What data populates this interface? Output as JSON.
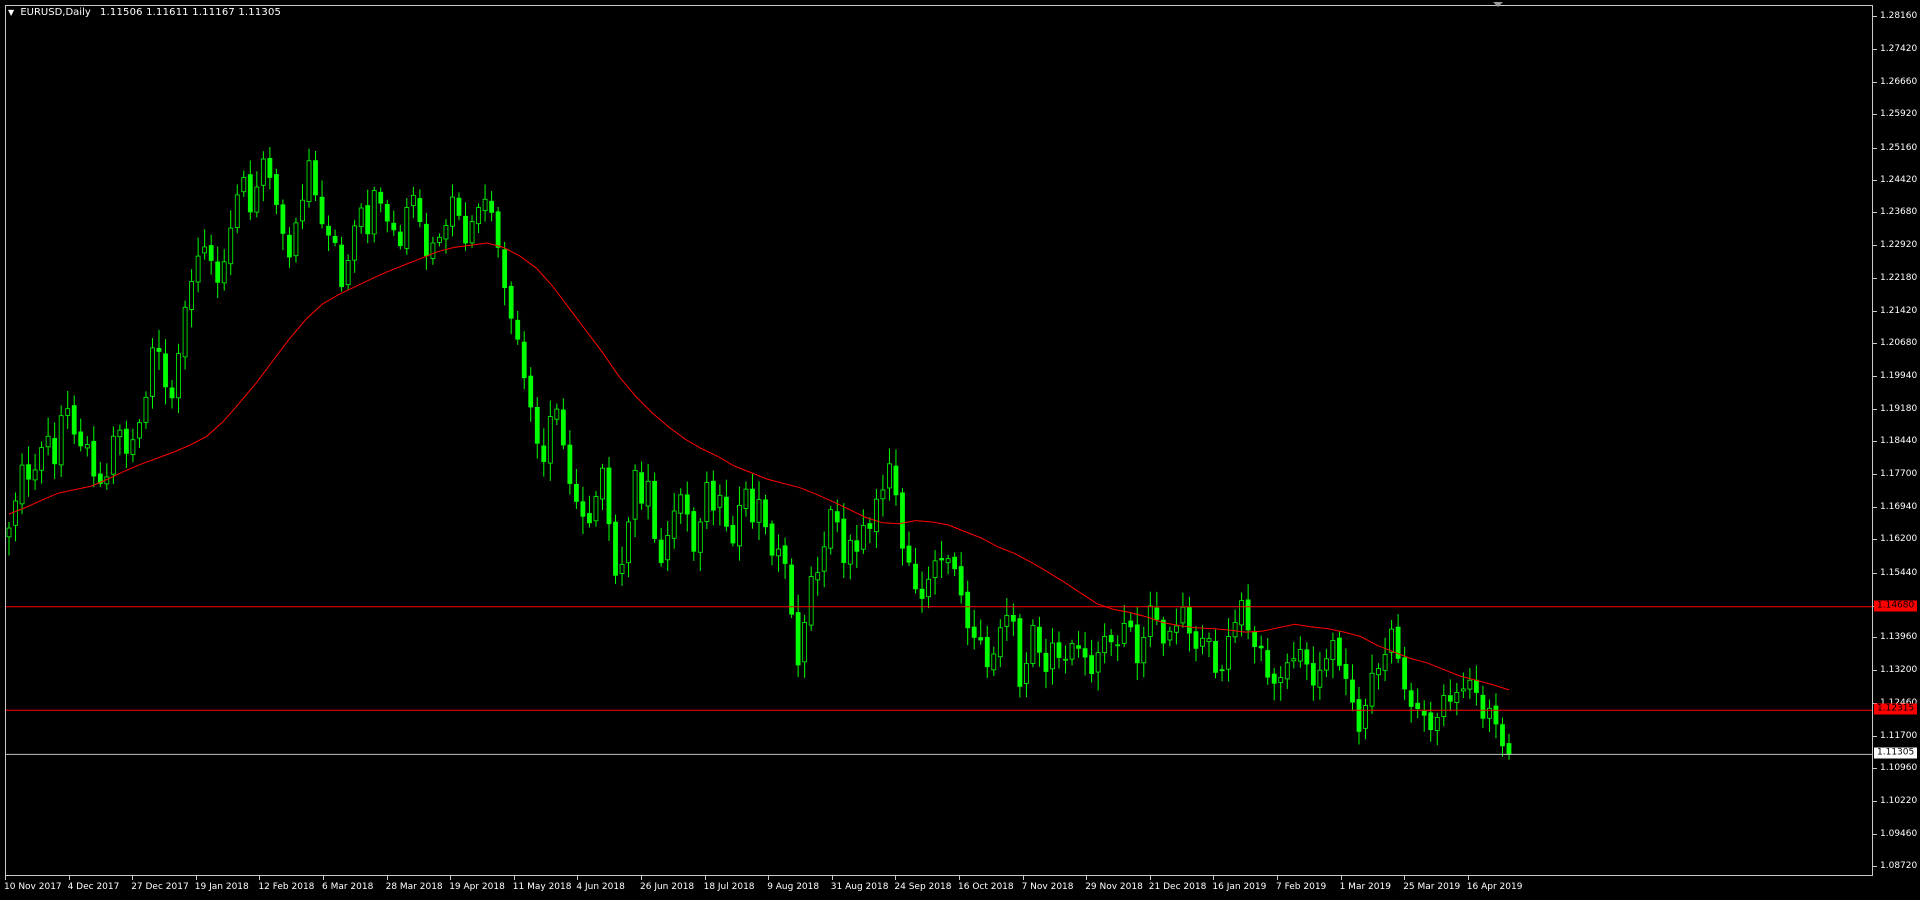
{
  "header": {
    "symbol": "EURUSD,Daily",
    "ohlc": "1.11506 1.11611 1.11167 1.11305"
  },
  "icons": {
    "menu": "triangle-down-icon",
    "scroll": "scroll-marker-icon"
  },
  "colors": {
    "background": "#000000",
    "bull": "#00ff00",
    "bear": "#00ff00",
    "moving_average": "#ff0000",
    "horizontal_level": "#ff0000",
    "bid_line": "#c0c0c0",
    "axis": "#c8c8c8"
  },
  "chart_data": {
    "type": "candlestick",
    "symbol": "EURUSD",
    "timeframe": "Daily",
    "ylim": [
      1.085,
      1.2842
    ],
    "x_tick_labels": [
      "10 Nov 2017",
      "4 Dec 2017",
      "27 Dec 2017",
      "19 Jan 2018",
      "12 Feb 2018",
      "6 Mar 2018",
      "28 Mar 2018",
      "19 Apr 2018",
      "11 May 2018",
      "4 Jun 2018",
      "26 Jun 2018",
      "18 Jul 2018",
      "9 Aug 2018",
      "31 Aug 2018",
      "24 Sep 2018",
      "16 Oct 2018",
      "7 Nov 2018",
      "29 Nov 2018",
      "21 Dec 2018",
      "16 Jan 2019",
      "7 Feb 2019",
      "1 Mar 2019",
      "25 Mar 2019",
      "16 Apr 2019"
    ],
    "y_tick_labels": [
      "1.28160",
      "1.27420",
      "1.26660",
      "1.25920",
      "1.25160",
      "1.24420",
      "1.23680",
      "1.22920",
      "1.22180",
      "1.21420",
      "1.20680",
      "1.19940",
      "1.19180",
      "1.18440",
      "1.17700",
      "1.16940",
      "1.16200",
      "1.15440",
      "1.14680",
      "1.13960",
      "1.13200",
      "1.12460",
      "1.11700",
      "1.10960",
      "1.10220",
      "1.09460",
      "1.08720"
    ],
    "grid": false,
    "close_series": [
      1.1648,
      1.171,
      1.1792,
      1.176,
      1.1781,
      1.1832,
      1.1858,
      1.1795,
      1.1905,
      1.1921,
      1.1863,
      1.1836,
      1.1839,
      1.1767,
      1.175,
      1.1765,
      1.1858,
      1.1872,
      1.1819,
      1.185,
      1.1889,
      1.1947,
      1.206,
      1.2052,
      1.1971,
      1.1946,
      1.2047,
      1.2153,
      1.2212,
      1.227,
      1.2291,
      1.226,
      1.221,
      1.2257,
      1.2334,
      1.241,
      1.245,
      1.2371,
      1.2428,
      1.2492,
      1.245,
      1.2388,
      1.2322,
      1.2268,
      1.2346,
      1.2398,
      1.2488,
      1.241,
      1.2344,
      1.2318,
      1.2301,
      1.22,
      1.226,
      1.2339,
      1.238,
      1.2321,
      1.242,
      1.2391,
      1.235,
      1.233,
      1.2294,
      1.2381,
      1.2409,
      1.2349,
      1.2271,
      1.23,
      1.2313,
      1.234,
      1.2405,
      1.2363,
      1.23,
      1.2349,
      1.2381,
      1.24,
      1.237,
      1.229,
      1.2198,
      1.2128,
      1.208,
      1.1992,
      1.1925,
      1.1842,
      1.18,
      1.1903,
      1.192,
      1.1838,
      1.175,
      1.1709,
      1.1675,
      1.166,
      1.172,
      1.1785,
      1.1658,
      1.154,
      1.1565,
      1.1662,
      1.178,
      1.1705,
      1.1755,
      1.1624,
      1.1569,
      1.1631,
      1.1687,
      1.1724,
      1.168,
      1.1595,
      1.1662,
      1.1752,
      1.1689,
      1.1723,
      1.1652,
      1.1614,
      1.17,
      1.1737,
      1.1662,
      1.1713,
      1.1651,
      1.1586,
      1.16,
      1.1567,
      1.1451,
      1.1335,
      1.1432,
      1.1537,
      1.1546,
      1.1605,
      1.169,
      1.1662,
      1.1569,
      1.162,
      1.1595,
      1.1654,
      1.1647,
      1.1714,
      1.1735,
      1.1795,
      1.1724,
      1.1602,
      1.157,
      1.1509,
      1.1487,
      1.1531,
      1.1573,
      1.1575,
      1.1578,
      1.1555,
      1.1495,
      1.142,
      1.1398,
      1.1392,
      1.1331,
      1.136,
      1.142,
      1.1448,
      1.1435,
      1.1286,
      1.1338,
      1.1425,
      1.1364,
      1.132,
      1.1385,
      1.1352,
      1.1348,
      1.1384,
      1.1373,
      1.1353,
      1.1315,
      1.1363,
      1.14,
      1.1388,
      1.1381,
      1.143,
      1.1422,
      1.134,
      1.1398,
      1.147,
      1.1439,
      1.1385,
      1.1412,
      1.1424,
      1.1467,
      1.1408,
      1.1373,
      1.1396,
      1.1395,
      1.1318,
      1.1322,
      1.14,
      1.1432,
      1.1482,
      1.1415,
      1.1377,
      1.1374,
      1.1307,
      1.1293,
      1.1306,
      1.134,
      1.1349,
      1.137,
      1.1337,
      1.1289,
      1.1323,
      1.1349,
      1.1391,
      1.1334,
      1.1304,
      1.125,
      1.1183,
      1.1242,
      1.1316,
      1.1327,
      1.1359,
      1.1417,
      1.135,
      1.128,
      1.124,
      1.1235,
      1.122,
      1.1187,
      1.1215,
      1.1265,
      1.1252,
      1.1272,
      1.128,
      1.13,
      1.1272,
      1.1213,
      1.1236,
      1.12,
      1.115,
      1.113
    ],
    "moving_average_close_series": [
      1.168,
      1.1695,
      1.1712,
      1.1728,
      1.1736,
      1.1744,
      1.176,
      1.1778,
      1.1794,
      1.1808,
      1.1822,
      1.1838,
      1.1858,
      1.1892,
      1.1935,
      1.198,
      1.203,
      1.208,
      1.2125,
      1.216,
      1.2182,
      1.22,
      1.2218,
      1.2235,
      1.225,
      1.2265,
      1.228,
      1.229,
      1.2295,
      1.23,
      1.229,
      1.227,
      1.2242,
      1.22,
      1.215,
      1.21,
      1.205,
      1.1995,
      1.195,
      1.1912,
      1.188,
      1.1852,
      1.183,
      1.1812,
      1.179,
      1.1775,
      1.176,
      1.175,
      1.174,
      1.1725,
      1.1708,
      1.169,
      1.1672,
      1.166,
      1.1658,
      1.1665,
      1.1662,
      1.1655,
      1.164,
      1.1625,
      1.1605,
      1.159,
      1.157,
      1.1548,
      1.1525,
      1.15,
      1.1475,
      1.1462,
      1.1455,
      1.1445,
      1.1432,
      1.1425,
      1.142,
      1.1418,
      1.1415,
      1.141,
      1.1412,
      1.142,
      1.1428,
      1.1422,
      1.1418,
      1.141,
      1.14,
      1.138,
      1.1365,
      1.135,
      1.134,
      1.1325,
      1.131,
      1.13,
      1.129,
      1.1278
    ],
    "horizontal_levels": [
      1.1468,
      1.12315
    ],
    "horizontal_level_labels": [
      "1.14680",
      "1.12315"
    ],
    "bid": 1.11305,
    "bid_label": "1.11305"
  }
}
